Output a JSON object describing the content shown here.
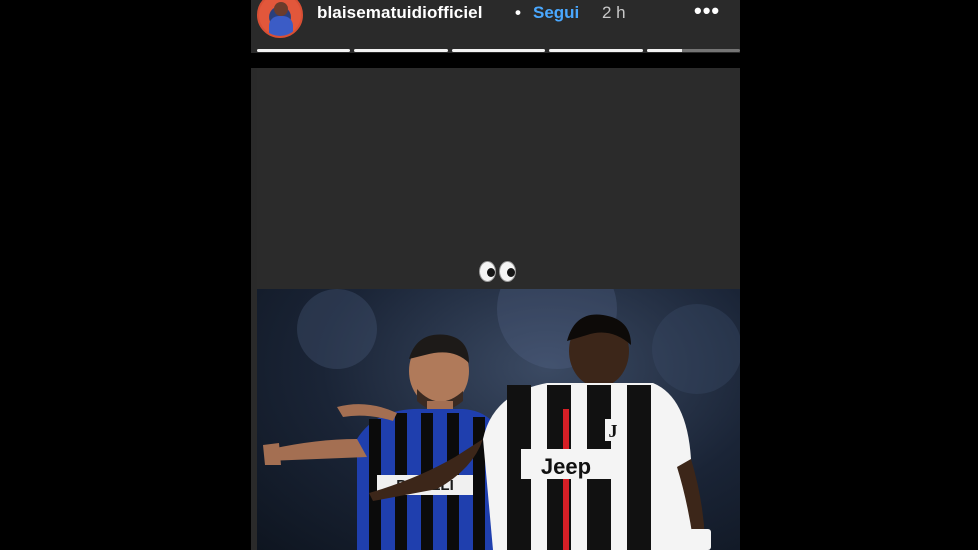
{
  "header": {
    "username": "blaisematuidiofficiel",
    "separator": "•",
    "follow_label": "Segui",
    "time_ago": "2 h",
    "more_label": "•••"
  },
  "progress": {
    "segments": [
      1,
      1,
      1,
      1,
      0.38
    ]
  },
  "story": {
    "sticker_icon": "eyes-emoji-icon",
    "photo_icons": [
      "inter-player",
      "juventus-player"
    ]
  },
  "colors": {
    "follow": "#4aa8ff",
    "background": "#000000",
    "story_bg": "#2b2b2b"
  }
}
